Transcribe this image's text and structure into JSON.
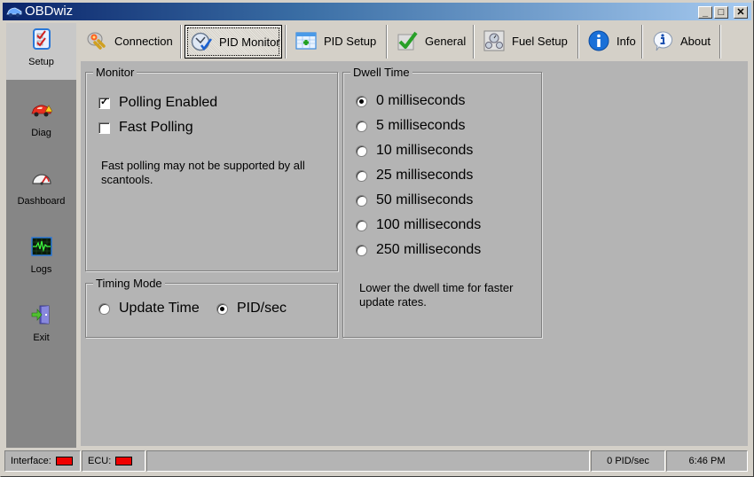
{
  "window": {
    "title": "OBDwiz",
    "controls": {
      "minimize": "_",
      "maximize": "□",
      "close": "✕"
    }
  },
  "sidebar": {
    "items": [
      {
        "label": "Setup",
        "icon": "checklist-icon",
        "active": true
      },
      {
        "label": "Diag",
        "icon": "car-warning-icon",
        "active": false
      },
      {
        "label": "Dashboard",
        "icon": "gauge-icon",
        "active": false
      },
      {
        "label": "Logs",
        "icon": "waveform-monitor-icon",
        "active": false
      },
      {
        "label": "Exit",
        "icon": "exit-door-icon",
        "active": false
      }
    ]
  },
  "tabs": [
    {
      "label": "Connection",
      "icon": "plug-connector-icon",
      "active": false
    },
    {
      "label": "PID Monitor",
      "icon": "pid-monitor-icon",
      "active": true
    },
    {
      "label": "PID Setup",
      "icon": "table-add-icon",
      "active": false
    },
    {
      "label": "General",
      "icon": "checkmark-icon",
      "active": false
    },
    {
      "label": "Fuel Setup",
      "icon": "fuel-gauges-icon",
      "active": false
    },
    {
      "label": "Info",
      "icon": "info-icon",
      "active": false
    },
    {
      "label": "About",
      "icon": "about-bubble-icon",
      "active": false
    }
  ],
  "monitor": {
    "legend": "Monitor",
    "polling_enabled": {
      "label": "Polling Enabled",
      "checked": true
    },
    "fast_polling": {
      "label": "Fast Polling",
      "checked": false
    },
    "note": "Fast polling may not be supported by all scantools."
  },
  "timing_mode": {
    "legend": "Timing Mode",
    "options": [
      {
        "label": "Update Time",
        "selected": false
      },
      {
        "label": "PID/sec",
        "selected": true
      }
    ]
  },
  "dwell_time": {
    "legend": "Dwell Time",
    "options": [
      {
        "label": "0 milliseconds",
        "selected": true
      },
      {
        "label": "5 milliseconds",
        "selected": false
      },
      {
        "label": "10 milliseconds",
        "selected": false
      },
      {
        "label": "25 milliseconds",
        "selected": false
      },
      {
        "label": "50 milliseconds",
        "selected": false
      },
      {
        "label": "100 milliseconds",
        "selected": false
      },
      {
        "label": "250 milliseconds",
        "selected": false
      }
    ],
    "note": "Lower the dwell time for faster update rates."
  },
  "statusbar": {
    "interface_label": "Interface:",
    "interface_status_color": "#f00000",
    "ecu_label": "ECU:",
    "ecu_status_color": "#f00000",
    "message": "",
    "pid_rate": "0 PID/sec",
    "clock": "6:46 PM"
  }
}
